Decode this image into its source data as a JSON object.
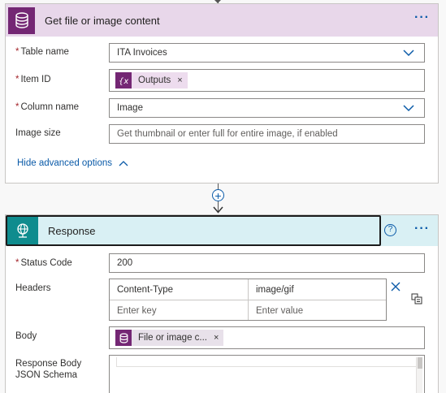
{
  "action1": {
    "title": "Get file or image content",
    "more_label": "···",
    "fields": {
      "table_name": {
        "label": "Table name",
        "value": "ITA Invoices"
      },
      "item_id": {
        "label": "Item ID",
        "token": "Outputs",
        "token_remove": "×"
      },
      "column_name": {
        "label": "Column name",
        "value": "Image"
      },
      "image_size": {
        "label": "Image size",
        "placeholder": "Get thumbnail or enter full for entire image, if enabled"
      }
    },
    "advanced_toggle": "Hide advanced options",
    "required_mark": "*"
  },
  "connector": {
    "add_label": "+"
  },
  "action2": {
    "title": "Response",
    "help_label": "?",
    "more_label": "···",
    "fields": {
      "status_code": {
        "label": "Status Code",
        "value": "200"
      },
      "headers": {
        "label": "Headers",
        "rows": [
          {
            "key": "Content-Type",
            "value": "image/gif"
          }
        ],
        "key_placeholder": "Enter key",
        "value_placeholder": "Enter value"
      },
      "body": {
        "label": "Body",
        "token": "File or image c...",
        "token_remove": "×"
      },
      "schema": {
        "label": "Response Body JSON Schema"
      }
    },
    "required_mark": "*"
  },
  "colors": {
    "accent": "#0a5aa8",
    "action1_header": "#e8d7ea",
    "action1_icon": "#742774",
    "action2_header": "#d9f0f4",
    "action2_icon": "#0f8c8e",
    "required": "#a4262c"
  },
  "icons": {
    "action1": "database-icon",
    "action2": "globe-icon",
    "token_outputs": "expression-icon",
    "token_body": "database-icon"
  }
}
